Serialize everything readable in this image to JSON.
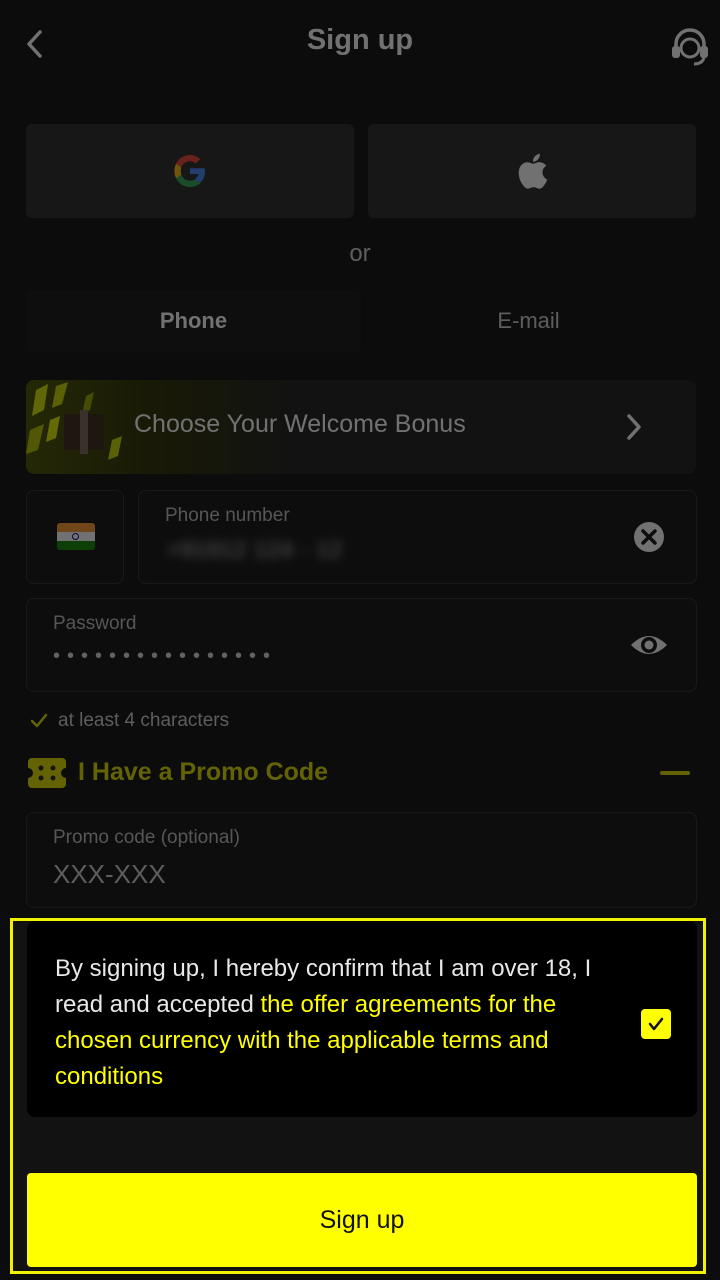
{
  "header": {
    "title": "Sign up",
    "back_icon": "chevron-left-icon",
    "support_icon": "headset-icon"
  },
  "social": {
    "google_icon": "google-icon",
    "apple_icon": "apple-icon"
  },
  "separator": {
    "or": "or"
  },
  "tabs": [
    {
      "label": "Phone",
      "active": true
    },
    {
      "label": "E-mail",
      "active": false
    }
  ],
  "bonus": {
    "label": "Choose Your Welcome Bonus",
    "icon": "chevron-right-icon"
  },
  "phone": {
    "country_flag": "india-flag-icon",
    "label": "Phone number",
    "value": "+91912 124 - 12",
    "clear_icon": "clear-icon"
  },
  "password": {
    "label": "Password",
    "value": "••••••••••••••••",
    "visibility_icon": "eye-icon"
  },
  "password_hint": {
    "text": "at least 4 characters",
    "icon": "check-icon"
  },
  "promo": {
    "title": "I Have a Promo Code",
    "collapse_icon": "minus-icon",
    "label": "Promo code (optional)",
    "placeholder": "XXX-XXX"
  },
  "terms": {
    "text": "By signing up, I hereby confirm that I am over 18, I read and accepted ",
    "link": "the offer agreements for the chosen currency with the applicable terms and conditions",
    "checked": true
  },
  "signup_button": {
    "label": "Sign up"
  },
  "colors": {
    "accent": "#ffff00",
    "background": "#0c0c0c"
  }
}
